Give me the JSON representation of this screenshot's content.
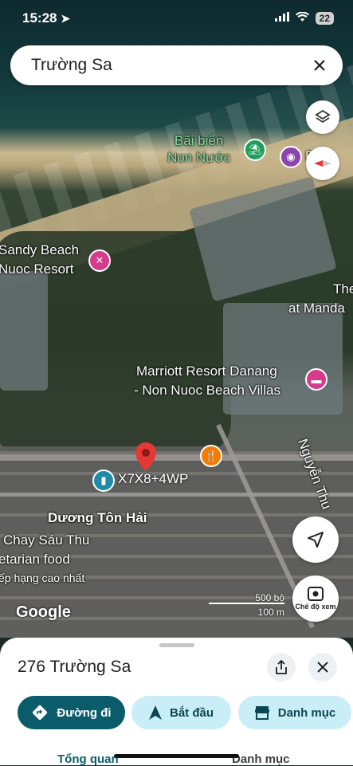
{
  "status_bar": {
    "time": "15:28",
    "battery": "22"
  },
  "search": {
    "query": "Trường Sa"
  },
  "map": {
    "labels": {
      "beach": "Bãi biển\nNon Nước",
      "sandy_beach_1": "Sandy Beach",
      "sandy_beach_2": "Nuoc Resort",
      "marriott_1": "Marriott Resort Danang",
      "marriott_2": "- Non Nuoc Beach Villas",
      "the": "The",
      "mandala": "at Manda",
      "partial_right": "Bảo",
      "street_nguyen": "Nguyễn Thu",
      "duong_ton_hai": "Dương Tôn Hải",
      "chay": "Chay Sáu Thu",
      "veg": "etarian food",
      "rank": "ếp hạng cao nhất"
    },
    "plus_code": "X7X8+4WP",
    "scale": {
      "feet": "500 bộ",
      "meters": "100 m"
    },
    "google": "Google",
    "mode_label": "Chế độ xem",
    "colors": {
      "pin": "#e53935",
      "poi_pink": "#d63a8a",
      "poi_purple": "#8e44ad",
      "poi_teal": "#1e8ca6",
      "poi_orange": "#f57c00"
    }
  },
  "sheet": {
    "title": "276 Trường Sa",
    "buttons": {
      "directions": "Đường đi",
      "start": "Bắt đầu",
      "catalog": "Danh mục"
    },
    "tabs": {
      "overview": "Tổng quan",
      "catalog": "Danh mục"
    }
  }
}
